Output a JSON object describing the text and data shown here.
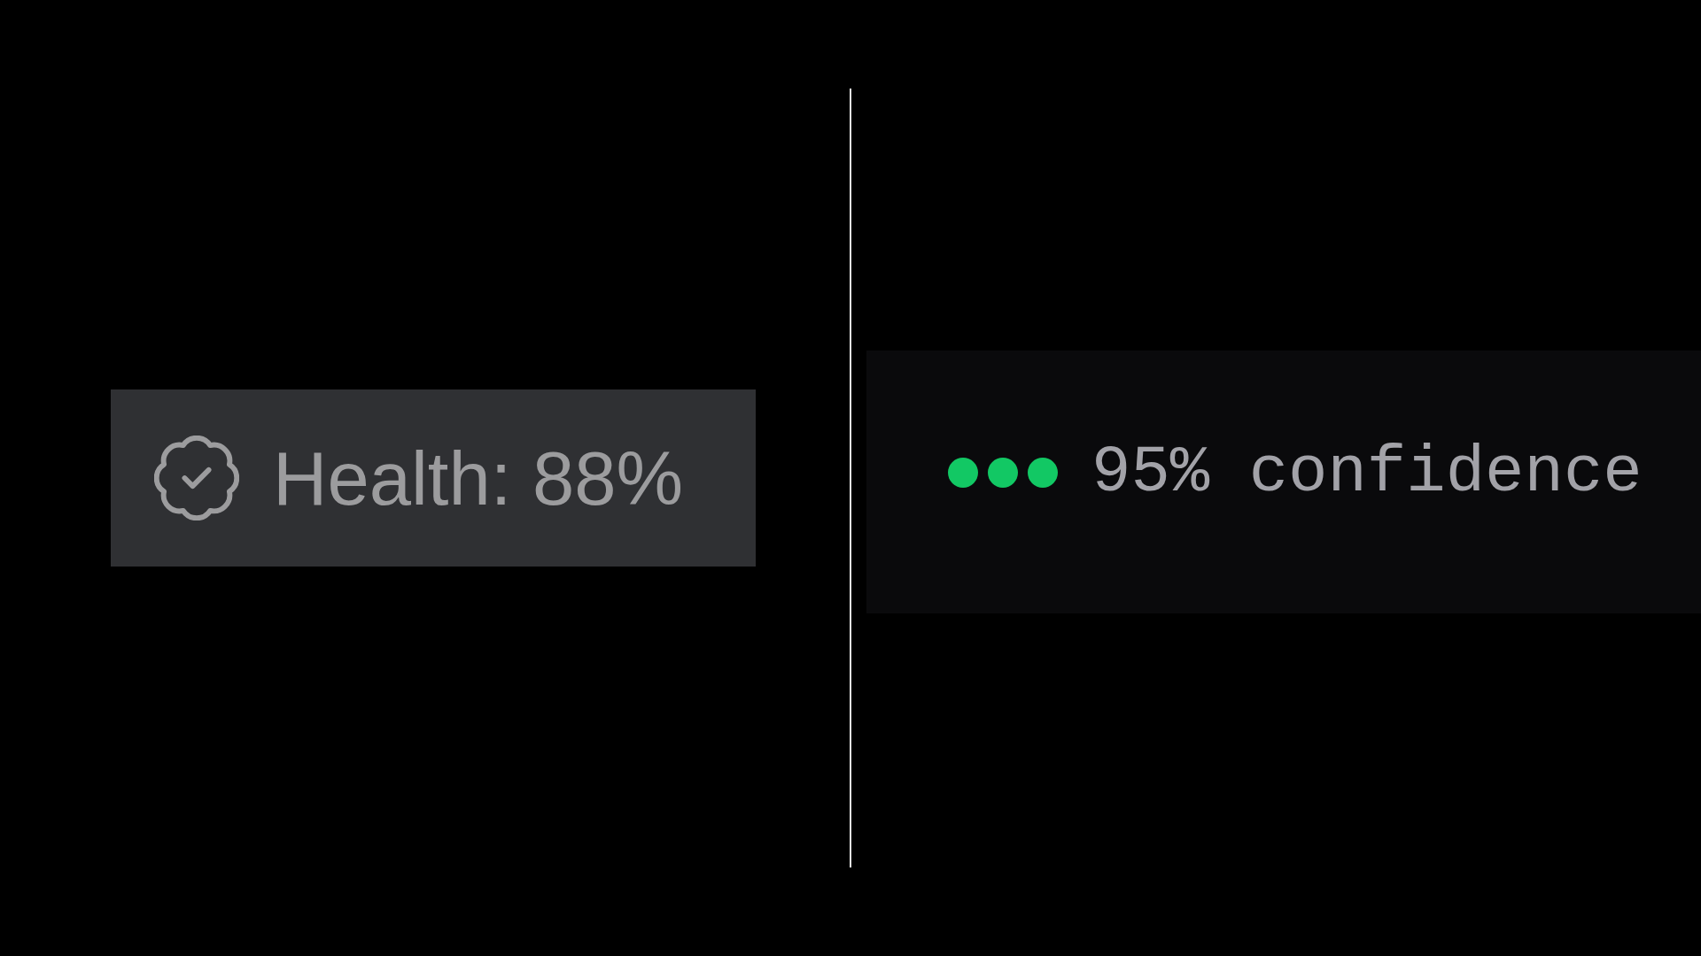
{
  "health_badge": {
    "label": "Health: 88%"
  },
  "confidence": {
    "dots": [
      {
        "filled": true
      },
      {
        "filled": true
      },
      {
        "filled": true
      }
    ],
    "label": "95% confidence"
  }
}
